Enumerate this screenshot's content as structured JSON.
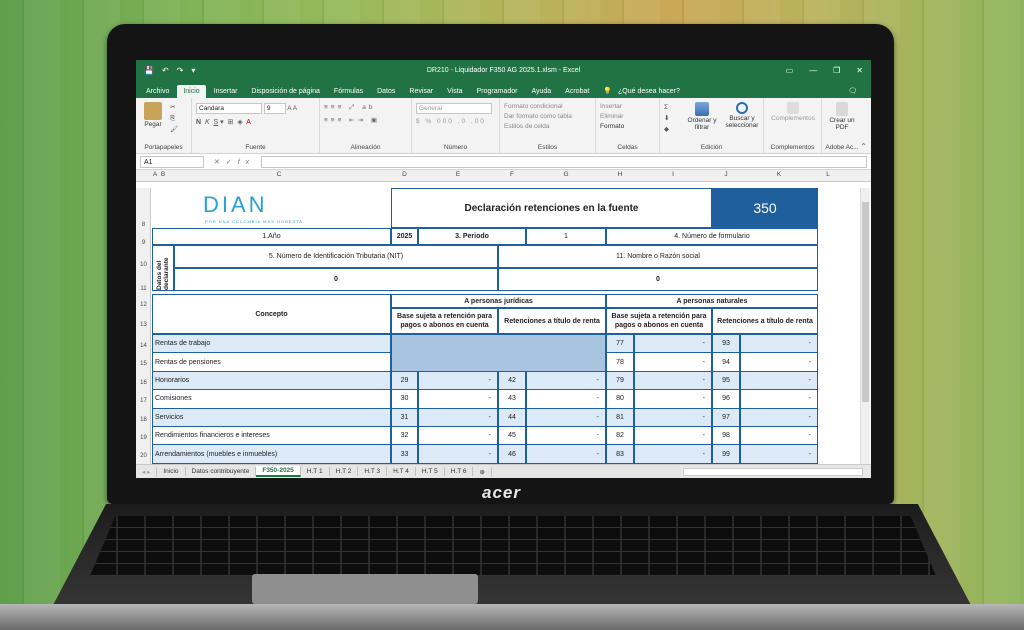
{
  "window": {
    "title": "DR210 - Liquidador F350 AG 2025.1.xlsm  -  Excel",
    "controls": [
      "▭",
      "—",
      "❐",
      "✕"
    ]
  },
  "ribbon_tabs": [
    "Archivo",
    "Inicio",
    "Insertar",
    "Disposición de página",
    "Fórmulas",
    "Datos",
    "Revisar",
    "Vista",
    "Programador",
    "Ayuda",
    "Acrobat"
  ],
  "help_search": "¿Qué desea hacer?",
  "ribbon": {
    "paste": "Pegar",
    "portapapeles": "Portapapeles",
    "font_name": "Candara",
    "font_size": "9",
    "font_group": "Fuente",
    "bold": "N",
    "italic": "K",
    "underline": "S",
    "alineacion": "Alineación",
    "number_format": "General",
    "numero": "Número",
    "cond_format": "Formato condicional",
    "table_format": "Dar formato como tabla",
    "cell_styles": "Estilos de celda",
    "estilos": "Estilos",
    "insertar": "Insertar",
    "eliminar": "Eliminar",
    "formato": "Formato",
    "celdas": "Celdas",
    "sort": "Ordenar y filtrar",
    "find": "Buscar y seleccionar",
    "edicion": "Edición",
    "complementos_btn": "Complementos",
    "complementos": "Complementos",
    "crear_pdf": "Crear un PDF",
    "adobe": "Adobe Ac..."
  },
  "formula_bar": {
    "name_box": "A1",
    "fx": "fx",
    "value": ""
  },
  "columns": [
    "A",
    "B",
    "C",
    "D",
    "E",
    "F",
    "G",
    "H",
    "I",
    "J",
    "K",
    "L"
  ],
  "rows": [
    "8",
    "9",
    "10",
    "11",
    "12",
    "13",
    "14",
    "15",
    "16",
    "17",
    "18",
    "19",
    "20"
  ],
  "form": {
    "logo": "DIAN",
    "logo_sub": "POR UNA COLOMBIA MÁS HONESTA",
    "title": "Declaración retenciones en la fuente",
    "form_number": "350",
    "año_label": "1.Año",
    "año_value": "2025",
    "periodo_label": "3. Periodo",
    "periodo_value": "1",
    "num_form_label": "4. Número de formulario",
    "datos_declarante": "Datos del declarante",
    "nit_label": "5. Número de Identificación Tributaria (NIT)",
    "nit_value": "0",
    "razon_label": "11. Nombre o Razón social",
    "razon_value": "0",
    "concepto": "Concepto",
    "juridicas": "A personas jurídicas",
    "naturales": "A personas naturales",
    "base": "Base sujeta a retención para pagos o abonos en cuenta",
    "retenciones": "Retenciones a título de renta",
    "dash": "-",
    "concepts": [
      {
        "name": "Rentas de trabajo",
        "bj": "",
        "rj": "",
        "bn": "77",
        "rn": "93"
      },
      {
        "name": "Rentas de pensiones",
        "bj": "",
        "rj": "",
        "bn": "78",
        "rn": "94"
      },
      {
        "name": "Honorarios",
        "bj": "29",
        "rj": "42",
        "bn": "79",
        "rn": "95"
      },
      {
        "name": "Comisiones",
        "bj": "30",
        "rj": "43",
        "bn": "80",
        "rn": "96"
      },
      {
        "name": "Servicios",
        "bj": "31",
        "rj": "44",
        "bn": "81",
        "rn": "97"
      },
      {
        "name": "Rendimientos financieros e intereses",
        "bj": "32",
        "rj": "45",
        "bn": "82",
        "rn": "98"
      },
      {
        "name": "Arrendamientos (muebles e inmuebles)",
        "bj": "33",
        "rj": "46",
        "bn": "83",
        "rn": "99"
      }
    ]
  },
  "sheets": [
    "Inicio",
    "Datos contribuyente",
    "F350-2025",
    "H.T 1",
    "H.T 2",
    "H.T 3",
    "H.T 4",
    "H.T 5",
    "H.T 6"
  ],
  "active_sheet": "F350-2025",
  "laptop_brand": "acer",
  "colors": {
    "excel_green": "#217346",
    "form_blue": "#1f5f9e",
    "dian_blue": "#2aa0d6",
    "shade": "#a8c4e0"
  }
}
